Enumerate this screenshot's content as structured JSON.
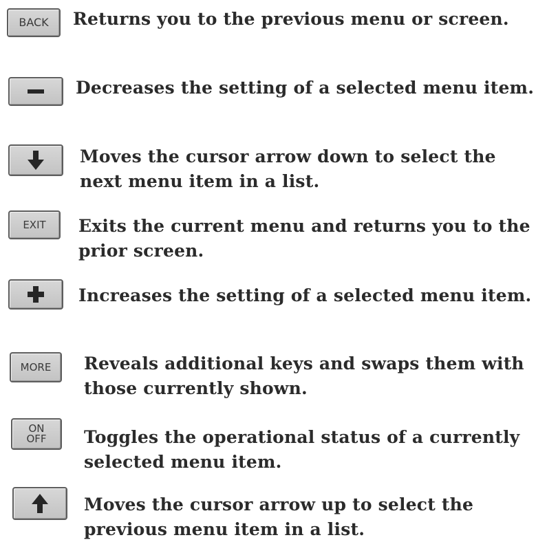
{
  "items": [
    {
      "key": "BACK",
      "description": "Returns you to the previous menu or screen."
    },
    {
      "key": "minus-icon",
      "description": "Decreases the setting of a selected menu item."
    },
    {
      "key": "down-arrow-icon",
      "description": "Moves the cursor arrow down to select the\nnext menu item in a list."
    },
    {
      "key": "EXIT",
      "description": "Exits the current menu and returns you to the\nprior screen."
    },
    {
      "key": "plus-icon",
      "description": "Increases the setting of a selected menu item."
    },
    {
      "key": "MORE",
      "description": "Reveals additional keys and swaps them with\nthose currently shown."
    },
    {
      "key": "ON\nOFF",
      "description": "Toggles the operational status of a currently\nselected menu item."
    },
    {
      "key": "up-arrow-icon",
      "description": "Moves the cursor arrow up to select the\nprevious menu item in a list."
    }
  ]
}
